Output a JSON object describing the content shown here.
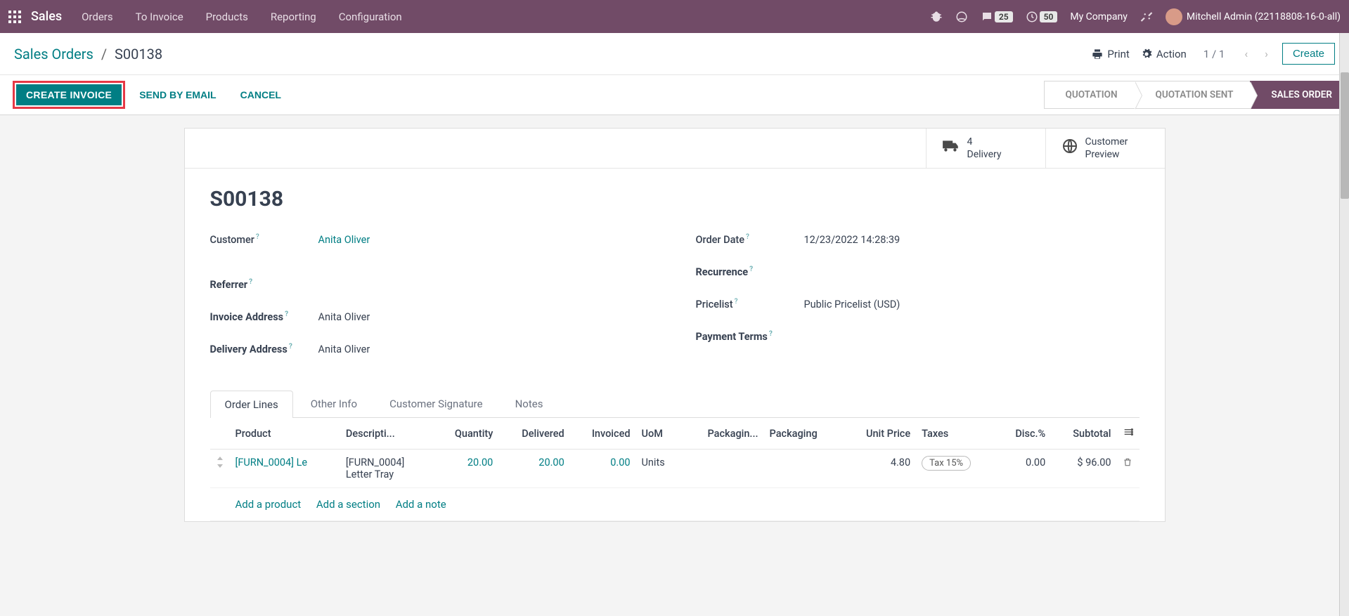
{
  "topnav": {
    "brand": "Sales",
    "menu": [
      "Orders",
      "To Invoice",
      "Products",
      "Reporting",
      "Configuration"
    ],
    "msg_badge": "25",
    "activity_badge": "50",
    "company": "My Company",
    "user": "Mitchell Admin (22118808-16-0-all)"
  },
  "breadcrumb": {
    "root": "Sales Orders",
    "current": "S00138"
  },
  "header_actions": {
    "print": "Print",
    "action": "Action",
    "pager": "1 / 1",
    "create": "Create"
  },
  "buttons": {
    "create_invoice": "CREATE INVOICE",
    "send_email": "SEND BY EMAIL",
    "cancel": "CANCEL"
  },
  "status": [
    "QUOTATION",
    "QUOTATION SENT",
    "SALES ORDER"
  ],
  "smart": {
    "delivery_count": "4",
    "delivery_label": "Delivery",
    "preview_l1": "Customer",
    "preview_l2": "Preview"
  },
  "order": {
    "name": "S00138",
    "customer_label": "Customer",
    "customer": "Anita Oliver",
    "referrer_label": "Referrer",
    "invoice_addr_label": "Invoice Address",
    "invoice_addr": "Anita Oliver",
    "delivery_addr_label": "Delivery Address",
    "delivery_addr": "Anita Oliver",
    "order_date_label": "Order Date",
    "order_date": "12/23/2022 14:28:39",
    "recurrence_label": "Recurrence",
    "pricelist_label": "Pricelist",
    "pricelist": "Public Pricelist (USD)",
    "payment_terms_label": "Payment Terms"
  },
  "tabs": [
    "Order Lines",
    "Other Info",
    "Customer Signature",
    "Notes"
  ],
  "table": {
    "headers": {
      "product": "Product",
      "description": "Descripti...",
      "quantity": "Quantity",
      "delivered": "Delivered",
      "invoiced": "Invoiced",
      "uom": "UoM",
      "packagin": "Packagin...",
      "packaging": "Packaging",
      "unit_price": "Unit Price",
      "taxes": "Taxes",
      "disc": "Disc.%",
      "subtotal": "Subtotal"
    },
    "row": {
      "product": "[FURN_0004] Le",
      "desc1": "[FURN_0004]",
      "desc2": "Letter Tray",
      "quantity": "20.00",
      "delivered": "20.00",
      "invoiced": "0.00",
      "uom": "Units",
      "unit_price": "4.80",
      "tax": "Tax 15%",
      "disc": "0.00",
      "subtotal": "$ 96.00"
    },
    "add": {
      "product": "Add a product",
      "section": "Add a section",
      "note": "Add a note"
    }
  }
}
